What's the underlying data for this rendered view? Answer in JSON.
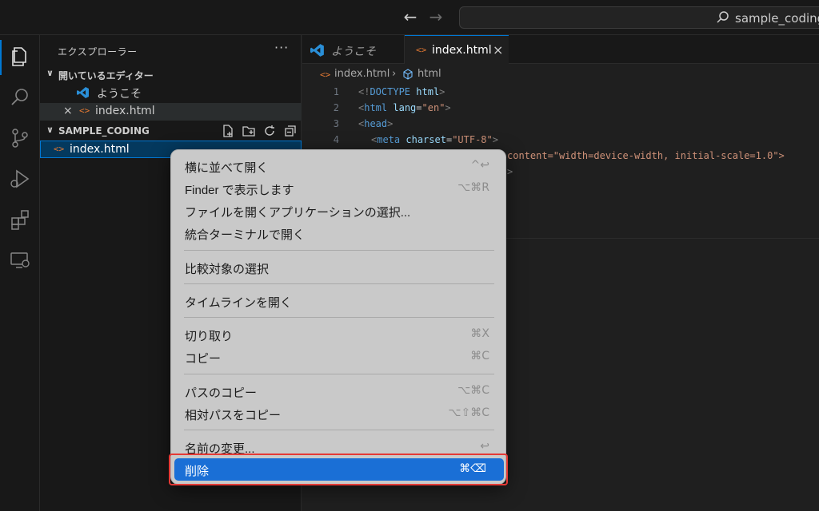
{
  "titlebar": {
    "back": "←",
    "forward": "→",
    "search_label": "sample_coding"
  },
  "sidebar": {
    "title": "エクスプローラー",
    "more": "···",
    "open_editors": {
      "title": "開いているエディター",
      "items": [
        {
          "label": "ようこそ",
          "icon": "vscode-logo-icon"
        },
        {
          "label": "index.html",
          "icon": "html-file-icon",
          "close": "×"
        }
      ]
    },
    "project": {
      "title": "SAMPLE_CODING",
      "files": [
        {
          "label": "index.html",
          "icon": "html-file-icon"
        }
      ]
    }
  },
  "tabs": [
    {
      "label": "ようこそ",
      "icon": "vscode-logo-icon"
    },
    {
      "label": "index.html",
      "icon": "html-file-icon",
      "close": "×"
    }
  ],
  "breadcrumb": {
    "file": "index.html",
    "sep": "›",
    "symbol": "html"
  },
  "editor": {
    "line_numbers": [
      "1",
      "2",
      "3",
      "4"
    ],
    "line5": "content=\"width=device-width, initial-scale=1.0\">",
    "line6": ">"
  },
  "context_menu": {
    "items": [
      {
        "label": "横に並べて開く",
        "shortcut": "^↩"
      },
      {
        "label": "Finder で表示します",
        "shortcut": "⌥⌘R"
      },
      {
        "label": "ファイルを開くアプリケーションの選択...",
        "shortcut": ""
      },
      {
        "label": "統合ターミナルで開く",
        "shortcut": ""
      },
      {
        "label": "比較対象の選択",
        "shortcut": ""
      },
      {
        "label": "タイムラインを開く",
        "shortcut": ""
      },
      {
        "label": "切り取り",
        "shortcut": "⌘X"
      },
      {
        "label": "コピー",
        "shortcut": "⌘C"
      },
      {
        "label": "パスのコピー",
        "shortcut": "⌥⌘C"
      },
      {
        "label": "相対パスをコピー",
        "shortcut": "⌥⇧⌘C"
      },
      {
        "label": "名前の変更...",
        "shortcut": "↩"
      },
      {
        "label": "削除",
        "shortcut": "⌘⌫"
      }
    ]
  },
  "colors": {
    "accent": "#0078d4",
    "menu_highlight": "#1a6fd6",
    "callout": "#e53935"
  }
}
